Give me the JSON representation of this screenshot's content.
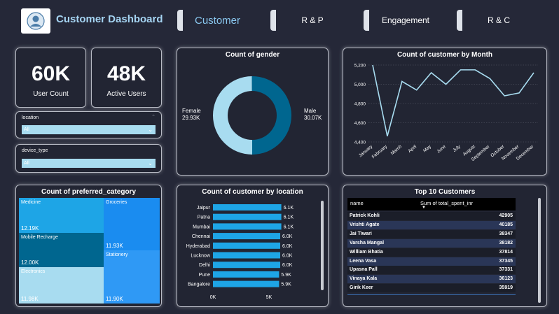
{
  "header": {
    "title": "Customer Dashboard",
    "tabs": [
      {
        "label": "Customer",
        "active": true
      },
      {
        "label": "R & P",
        "active": false
      },
      {
        "label": "Engagement",
        "active": false
      },
      {
        "label": "R & C",
        "active": false
      }
    ],
    "logo_icon": "user-avatar-icon"
  },
  "kpis": [
    {
      "value": "60K",
      "label": "User Count"
    },
    {
      "value": "48K",
      "label": "Active Users"
    }
  ],
  "slicers": [
    {
      "label": "location",
      "value": "All"
    },
    {
      "label": "device_type",
      "value": "All"
    }
  ],
  "colors": {
    "accent": "#a5d4f2",
    "dark_blue": "#00668f",
    "light_blue": "#a8dcf0",
    "bar": "#1ea5e6"
  },
  "gender_chart": {
    "title": "Count of gender",
    "female_label": "Female",
    "female_value": "29.93K",
    "male_label": "Male",
    "male_value": "30.07K"
  },
  "month_chart": {
    "title": "Count of customer by Month"
  },
  "category_chart": {
    "title": "Count of preferred_category",
    "items": [
      {
        "name": "Medicine",
        "value": "12.19K"
      },
      {
        "name": "Mobile Recharge",
        "value": "12.00K"
      },
      {
        "name": "Electronics",
        "value": "11.98K"
      },
      {
        "name": "Groceries",
        "value": "11.93K"
      },
      {
        "name": "Stationery",
        "value": "11.90K"
      }
    ]
  },
  "location_chart": {
    "title": "Count of customer by location"
  },
  "top_customers": {
    "title": "Top 10 Customers",
    "columns": [
      "name",
      "Sum of total_spent_inr"
    ],
    "rows": [
      {
        "name": "Patrick Kohli",
        "value": "42905"
      },
      {
        "name": "Vrishti Agate",
        "value": "40185"
      },
      {
        "name": "Jai Tiwari",
        "value": "38347"
      },
      {
        "name": "Varsha Mangal",
        "value": "38182"
      },
      {
        "name": "William Bhatia",
        "value": "37814"
      },
      {
        "name": "Leena Vasa",
        "value": "37345"
      },
      {
        "name": "Upasna Pall",
        "value": "37331"
      },
      {
        "name": "Vinaya Kala",
        "value": "36123"
      },
      {
        "name": "Girik Keer",
        "value": "35919"
      }
    ]
  },
  "chart_data": [
    {
      "type": "pie",
      "title": "Count of gender",
      "categories": [
        "Female",
        "Male"
      ],
      "values": [
        29930,
        30070
      ],
      "data_labels": [
        "29.93K",
        "30.07K"
      ],
      "donut": true,
      "colors": [
        "#a8dcf0",
        "#00668f"
      ]
    },
    {
      "type": "line",
      "title": "Count of customer by Month",
      "categories": [
        "January",
        "February",
        "March",
        "April",
        "May",
        "June",
        "July",
        "August",
        "September",
        "October",
        "November",
        "December"
      ],
      "values": [
        5200,
        4460,
        5030,
        4940,
        5120,
        5000,
        5150,
        5150,
        5060,
        4880,
        4910,
        5120
      ],
      "yticks": [
        "4,400",
        "4,600",
        "4,800",
        "5,000",
        "5,200"
      ],
      "ylim": [
        4400,
        5200
      ],
      "grid": true
    },
    {
      "type": "bar",
      "title": "Count of customer by location",
      "orientation": "horizontal",
      "categories": [
        "Jaipur",
        "Patna",
        "Mumbai",
        "Chennai",
        "Hyderabad",
        "Lucknow",
        "Delhi",
        "Pune",
        "Bangalore"
      ],
      "values": [
        6100,
        6100,
        6100,
        6000,
        6000,
        6000,
        6000,
        5900,
        5900
      ],
      "data_labels": [
        "6.1K",
        "6.1K",
        "6.1K",
        "6.0K",
        "6.0K",
        "6.0K",
        "6.0K",
        "5.9K",
        "5.9K"
      ],
      "xticks": [
        "0K",
        "5K"
      ],
      "xlim": [
        0,
        6500
      ]
    },
    {
      "type": "table",
      "title": "Top 10 Customers",
      "columns": [
        "name",
        "Sum of total_spent_inr"
      ],
      "rows": [
        [
          "Patrick Kohli",
          42905
        ],
        [
          "Vrishti Agate",
          40185
        ],
        [
          "Jai Tiwari",
          38347
        ],
        [
          "Varsha Mangal",
          38182
        ],
        [
          "William Bhatia",
          37814
        ],
        [
          "Leena Vasa",
          37345
        ],
        [
          "Upasna Pall",
          37331
        ],
        [
          "Vinaya Kala",
          36123
        ],
        [
          "Girik Keer",
          35919
        ]
      ]
    }
  ]
}
